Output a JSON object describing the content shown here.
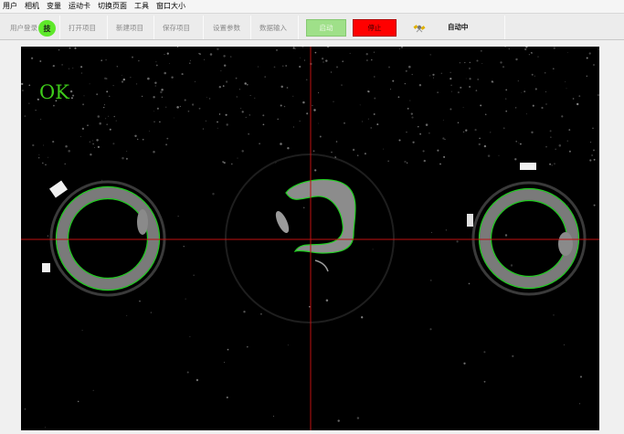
{
  "menu": {
    "items": [
      "用户",
      "相机",
      "变量",
      "运动卡",
      "切换页面",
      "工具",
      "窗口大小"
    ]
  },
  "toolbar": {
    "login_label": "用户登录",
    "tech_badge": "技",
    "open_label": "打开项目",
    "new_label": "新建项目",
    "save_label": "保存项目",
    "settings_label": "设置参数",
    "data_label": "数据输入",
    "start_label": "启动",
    "stop_label": "停止",
    "status_icon": "satellite-icon",
    "status_text": "自动中"
  },
  "viewer": {
    "result_text": "OK"
  },
  "colors": {
    "ok": "#3ecb1a",
    "start": "#9fe089",
    "stop": "#ff0000",
    "tech_badge": "#5ee82a",
    "crosshair": "#c01010",
    "contour": "#22d022"
  }
}
